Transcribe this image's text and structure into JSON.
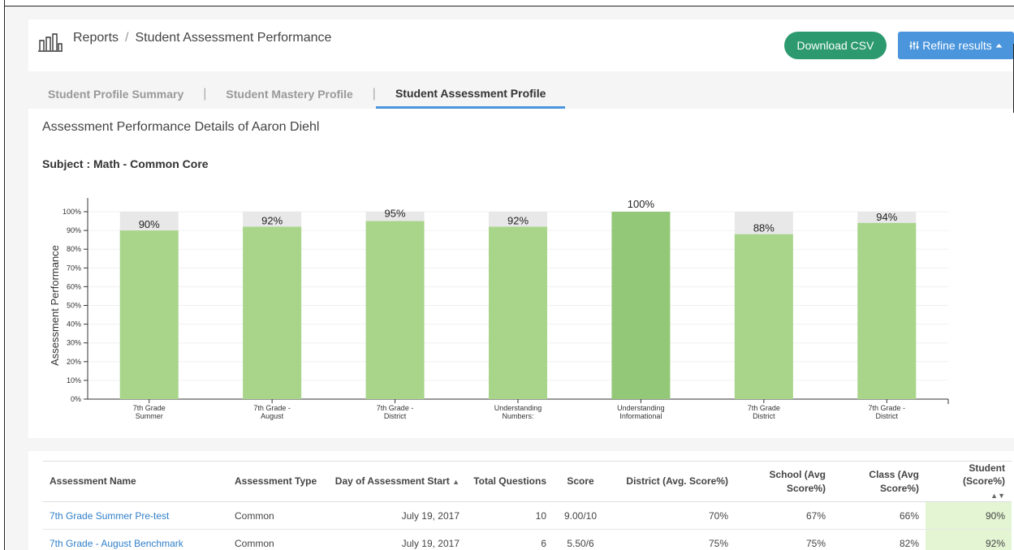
{
  "breadcrumb": {
    "root": "Reports",
    "separator": "/",
    "current": "Student Assessment Performance"
  },
  "actions": {
    "download_csv": "Download CSV",
    "refine_results": "Refine results"
  },
  "tabs": [
    {
      "label": "Student Profile Summary",
      "active": false
    },
    {
      "label": "Student Mastery Profile",
      "active": false
    },
    {
      "label": "Student Assessment Profile",
      "active": true
    }
  ],
  "tab_separator": "|",
  "panel": {
    "title": "Assessment Performance Details of Aaron Diehl",
    "subject": "Subject : Math - Common Core"
  },
  "colors": {
    "bar": "#a8d58a",
    "bar_highlight": "#93c878",
    "bar_background": "#e8e8e8",
    "accent_blue": "#4a95dc",
    "accent_green": "#2c9a6e"
  },
  "chart_data": {
    "type": "bar",
    "ylabel": "Assessment Performance",
    "xlabel": "",
    "ylim": [
      0,
      100
    ],
    "yticks": [
      "0%",
      "10%",
      "20%",
      "30%",
      "40%",
      "50%",
      "60%",
      "70%",
      "80%",
      "90%",
      "100%"
    ],
    "categories": [
      [
        "7th Grade",
        "Summer"
      ],
      [
        "7th Grade -",
        "August"
      ],
      [
        "7th Grade -",
        "District"
      ],
      [
        "Understanding",
        "Numbers:"
      ],
      [
        "Understanding",
        "Informational"
      ],
      [
        "7th Grade",
        "District"
      ],
      [
        "7th Grade -",
        "District"
      ]
    ],
    "values": [
      90,
      92,
      95,
      92,
      100,
      88,
      94
    ],
    "labels": [
      "90%",
      "92%",
      "95%",
      "92%",
      "100%",
      "88%",
      "94%"
    ],
    "grid": true,
    "legend": "none"
  },
  "table": {
    "headers": [
      "Assessment Name",
      "Assessment Type",
      "Day of Assessment Start",
      "Total Questions",
      "Score",
      "District (Avg. Score%)",
      "School (Avg Score%)",
      "Class (Avg Score%)",
      "Student (Score%)"
    ],
    "rows": [
      [
        "7th Grade Summer Pre-test",
        "Common",
        "July 19, 2017",
        "10",
        "9.00/10",
        "70%",
        "67%",
        "66%",
        "90%"
      ],
      [
        "7th Grade - August Benchmark",
        "Common",
        "July 19, 2017",
        "6",
        "5.50/6",
        "75%",
        "75%",
        "82%",
        "92%"
      ]
    ]
  }
}
